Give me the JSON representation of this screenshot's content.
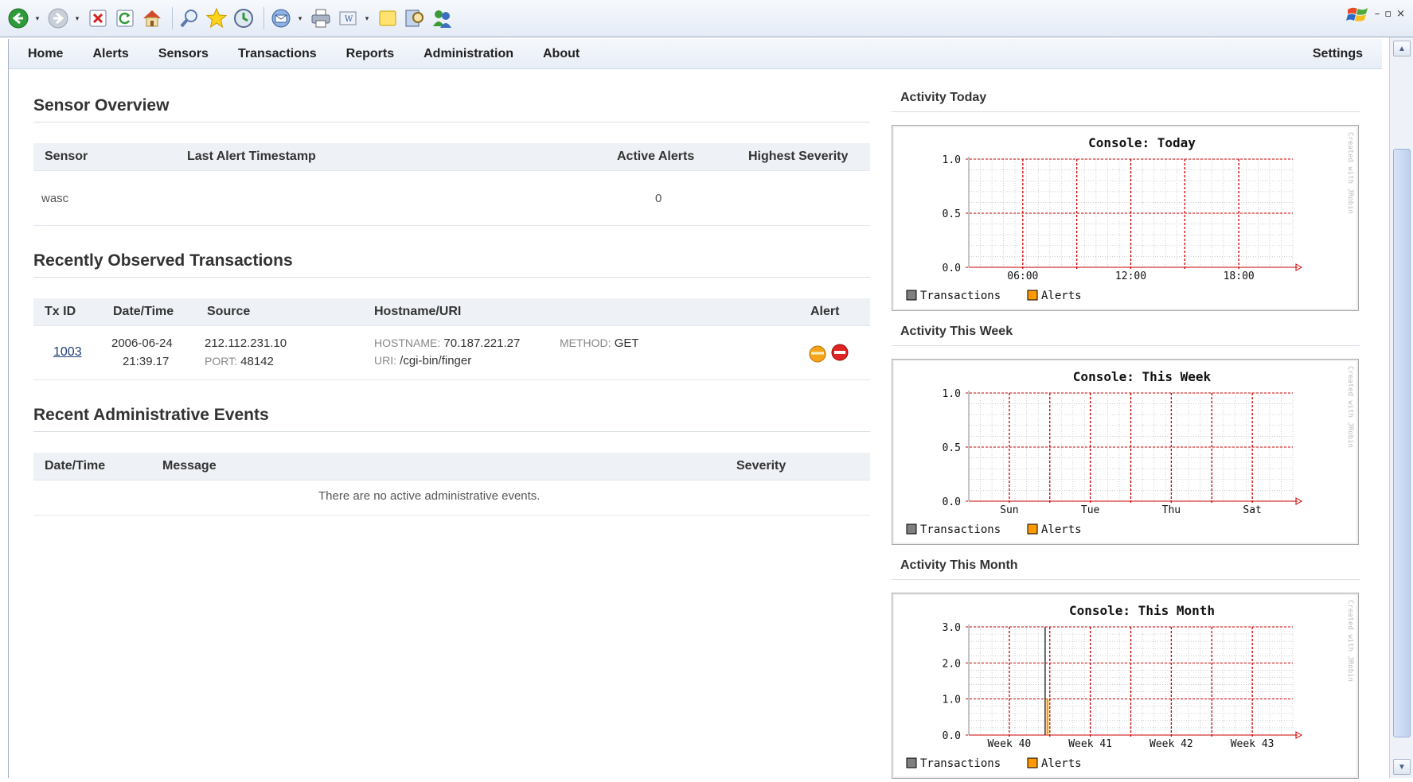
{
  "browser": {
    "toolbar_icons": [
      "back-icon",
      "forward-icon",
      "stop-icon",
      "refresh-icon",
      "home-icon",
      "search-icon",
      "favorites-icon",
      "history-icon",
      "mail-icon",
      "print-icon",
      "edit-icon",
      "discuss-icon",
      "research-icon",
      "messenger-icon"
    ],
    "window_controls": [
      "–",
      "̅",
      "×"
    ]
  },
  "nav": {
    "items": [
      "Home",
      "Alerts",
      "Sensors",
      "Transactions",
      "Reports",
      "Administration",
      "About"
    ],
    "settings": "Settings"
  },
  "sensor_overview": {
    "title": "Sensor Overview",
    "headers": [
      "Sensor",
      "Last Alert Timestamp",
      "Active Alerts",
      "Highest Severity"
    ],
    "rows": [
      {
        "sensor": "wasc",
        "last_alert": "",
        "active_alerts": "0",
        "highest_severity": ""
      }
    ]
  },
  "transactions": {
    "title": "Recently Observed Transactions",
    "headers": [
      "Tx ID",
      "Date/Time",
      "Source",
      "Hostname/URI",
      "Alert"
    ],
    "rows": [
      {
        "tx_id": "1003",
        "date": "2006-06-24",
        "time": "21:39.17",
        "source_ip": "212.112.231.10",
        "port_label": "PORT:",
        "port": "48142",
        "hostname_label": "HOSTNAME:",
        "hostname": "70.187.221.27",
        "method_label": "METHOD:",
        "method": "GET",
        "uri_label": "URI:",
        "uri": "/cgi-bin/finger"
      }
    ]
  },
  "admin_events": {
    "title": "Recent Administrative Events",
    "headers": [
      "Date/Time",
      "Message",
      "Severity"
    ],
    "empty_message": "There are no active administrative events."
  },
  "activity": {
    "today_title": "Activity Today",
    "week_title": "Activity This Week",
    "month_title": "Activity This Month"
  },
  "chart_data": [
    {
      "type": "line",
      "title": "Console: Today",
      "x_ticks": [
        "06:00",
        "12:00",
        "18:00"
      ],
      "y_ticks": [
        "0.0",
        "0.5",
        "1.0"
      ],
      "ylim": [
        0,
        1
      ],
      "legend": [
        "Transactions",
        "Alerts"
      ],
      "series": [
        {
          "name": "Transactions",
          "values": []
        },
        {
          "name": "Alerts",
          "values": []
        }
      ],
      "watermark": "Created with JRobin",
      "grid": true
    },
    {
      "type": "line",
      "title": "Console: This Week",
      "x_ticks": [
        "Sun",
        "Tue",
        "Thu",
        "Sat"
      ],
      "y_ticks": [
        "0.0",
        "0.5",
        "1.0"
      ],
      "ylim": [
        0,
        1
      ],
      "legend": [
        "Transactions",
        "Alerts"
      ],
      "series": [
        {
          "name": "Transactions",
          "values": []
        },
        {
          "name": "Alerts",
          "values": []
        }
      ],
      "watermark": "Created with JRobin",
      "grid": true
    },
    {
      "type": "line",
      "title": "Console: This Month",
      "x_ticks": [
        "Week 40",
        "Week 41",
        "Week 42",
        "Week 43"
      ],
      "y_ticks": [
        "0.0",
        "1.0",
        "2.0",
        "3.0"
      ],
      "ylim": [
        0,
        3
      ],
      "legend": [
        "Transactions",
        "Alerts"
      ],
      "series": [
        {
          "name": "Transactions",
          "values": []
        },
        {
          "name": "Alerts",
          "spike_at": "Week 40",
          "value": 1.0
        }
      ],
      "watermark": "Created with JRobin",
      "grid": true
    }
  ],
  "colors": {
    "transactions": "#7f7f7f",
    "alerts": "#ff9900",
    "grid_major": "#cc0000",
    "nav_bg": "#e8eef7"
  }
}
